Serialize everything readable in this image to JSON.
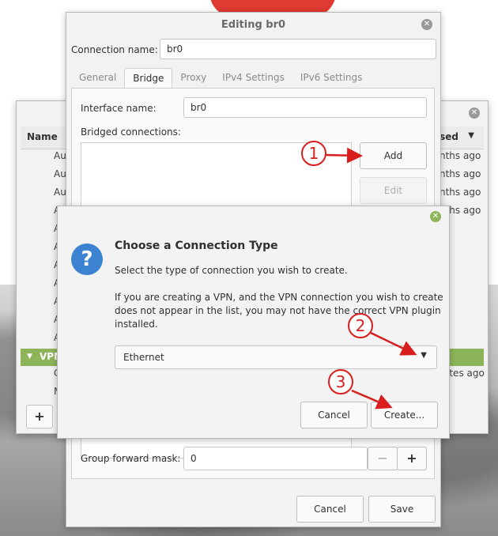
{
  "list_window": {
    "col_name": "Name",
    "col_used": "Used",
    "rows": [
      {
        "name": "Au",
        "used": "nths ago"
      },
      {
        "name": "Au",
        "used": "nths ago"
      },
      {
        "name": "Au",
        "used": "nths ago"
      },
      {
        "name": "A",
        "used": "nths ago"
      },
      {
        "name": "A",
        "used": ""
      },
      {
        "name": "A",
        "used": ""
      },
      {
        "name": "A",
        "used": ""
      },
      {
        "name": "A",
        "used": ""
      },
      {
        "name": "A",
        "used": ""
      },
      {
        "name": "A",
        "used": ""
      },
      {
        "name": "A",
        "used": ""
      }
    ],
    "vpn_label": "VPN",
    "vpn_child_1": "C",
    "vpn_child_1_used": "ates ago",
    "vpn_child_2": "M",
    "add_label": "+"
  },
  "edit_window": {
    "title": "Editing br0",
    "connection_name_label": "Connection name:",
    "connection_name_value": "br0",
    "tabs": [
      "General",
      "Bridge",
      "Proxy",
      "IPv4 Settings",
      "IPv6 Settings"
    ],
    "active_tab": "Bridge",
    "interface_name_label": "Interface name:",
    "interface_name_value": "br0",
    "bridged_connections_label": "Bridged connections:",
    "add_button": "Add",
    "edit_button": "Edit",
    "group_forward_mask_label": "Group forward mask:",
    "group_forward_mask_value": "0",
    "minus": "−",
    "plus": "+",
    "cancel_button": "Cancel",
    "save_button": "Save"
  },
  "dialog": {
    "title": "Choose a Connection Type",
    "subtitle": "Select the type of connection you wish to create.",
    "info_line1": "If you are creating a VPN, and the VPN connection you wish to create",
    "info_line2": "does not appear in the list, you may not have the correct VPN plugin",
    "info_line3": "installed.",
    "selected_type": "Ethernet",
    "cancel_button": "Cancel",
    "create_button": "Create..."
  },
  "annotations": [
    "1",
    "2",
    "3"
  ],
  "colors": {
    "accent_green": "#8eb45a",
    "annotation_red": "#d91e1e",
    "question_blue": "#3b83d0"
  }
}
